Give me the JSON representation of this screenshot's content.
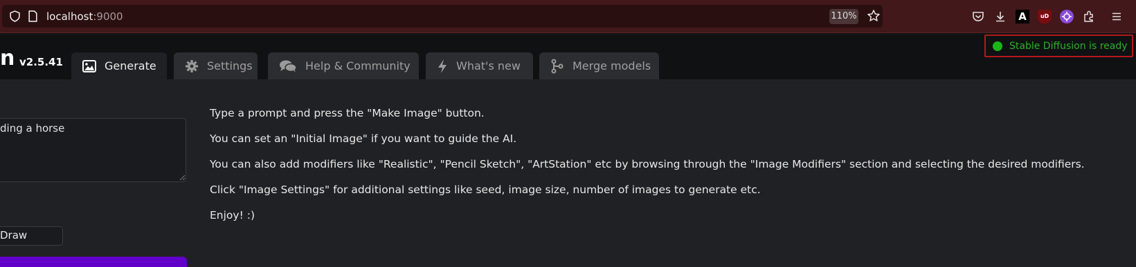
{
  "browser": {
    "url_host": "localhost",
    "url_port": ":9000",
    "zoom": "110%",
    "toolbar_icons": [
      "pocket-icon",
      "download-icon",
      "a-extension-icon",
      "ublock-icon",
      "purple-extension-icon",
      "extensions-icon",
      "menu-icon"
    ]
  },
  "app": {
    "brand_fragment": "n",
    "version": "v2.5.41",
    "status": "Stable Diffusion is ready",
    "status_color": "#1bb51b",
    "accent_color": "#6100c9"
  },
  "tabs": [
    {
      "label": "Generate",
      "icon": "image-icon",
      "active": true
    },
    {
      "label": "Settings",
      "icon": "gear-icon",
      "active": false
    },
    {
      "label": "Help & Community",
      "icon": "comments-icon",
      "active": false
    },
    {
      "label": "What's new",
      "icon": "bolt-icon",
      "active": false
    },
    {
      "label": "Merge models",
      "icon": "merge-icon",
      "active": false
    }
  ],
  "left_panel": {
    "prompt_value": "ding a horse",
    "draw_label": "Draw"
  },
  "instructions": [
    "Type a prompt and press the \"Make Image\" button.",
    "You can set an \"Initial Image\" if you want to guide the AI.",
    "You can also add modifiers like \"Realistic\", \"Pencil Sketch\", \"ArtStation\" etc by browsing through the \"Image Modifiers\" section and selecting the desired modifiers.",
    "Click \"Image Settings\" for additional settings like seed, image size, number of images to generate etc.",
    "Enjoy! :)"
  ]
}
